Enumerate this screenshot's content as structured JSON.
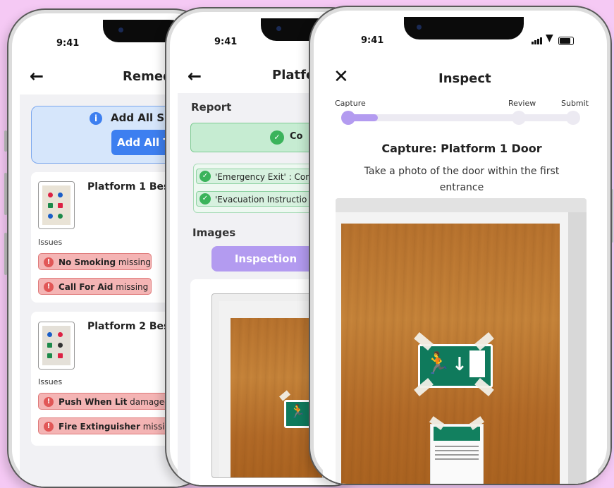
{
  "status_time": "9:41",
  "phone1": {
    "title": "Remed",
    "banner": {
      "text": "Add All Sig",
      "button": "Add All T"
    },
    "cards": [
      {
        "title": "Platform 1 Bes",
        "issues_label": "Issues",
        "issues": [
          {
            "name": "No Smoking",
            "status": "missing"
          },
          {
            "name": "Call For Aid",
            "status": "missing"
          }
        ]
      },
      {
        "title": "Platform 2 Bes",
        "issues_label": "Issues",
        "issues": [
          {
            "name": "Push When Lit",
            "status": "damaged"
          },
          {
            "name": "Fire Extinguisher",
            "status": "missing"
          }
        ]
      }
    ]
  },
  "phone2": {
    "title": "Platfo",
    "report_label": "Report",
    "report_status": "Co",
    "report_items": [
      "'Emergency Exit' : Com",
      "'Evacuation Instructio"
    ],
    "images_label": "Images",
    "inspection_button": "Inspection"
  },
  "phone3": {
    "title": "Inspect",
    "steps": [
      "Capture",
      "Review",
      "Submit"
    ],
    "progress": 0.15,
    "capture_title": "Capture: Platform 1 Door",
    "capture_text": "Take a photo of the door within the first entrance"
  },
  "colors": {
    "background": "#f5c9f4",
    "accent_purple": "#b39bf0",
    "accent_blue": "#3d7ff0",
    "issue_red": "#f4b4b4",
    "ok_green": "#c6ecd2"
  },
  "icons": {
    "back": "arrow-left-icon",
    "close": "close-icon",
    "info": "info-icon",
    "check": "check-circle-icon",
    "error": "exclamation-circle-icon"
  }
}
